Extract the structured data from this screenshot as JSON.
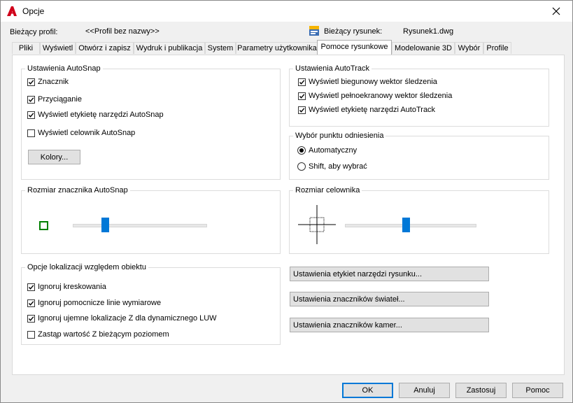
{
  "window": {
    "title": "Opcje",
    "close_glyph": "✕"
  },
  "header": {
    "profile_label": "Bieżący profil:",
    "profile_value": "<<Profil bez nazwy>>",
    "drawing_label": "Bieżący rysunek:",
    "drawing_value": "Rysunek1.dwg"
  },
  "tabs": [
    {
      "label": "Pliki"
    },
    {
      "label": "Wyświetl"
    },
    {
      "label": "Otwórz i zapisz"
    },
    {
      "label": "Wydruk i publikacja"
    },
    {
      "label": "System"
    },
    {
      "label": "Parametry użytkownika"
    },
    {
      "label": "Pomoce rysunkowe",
      "active": true
    },
    {
      "label": "Modelowanie 3D"
    },
    {
      "label": "Wybór"
    },
    {
      "label": "Profile"
    }
  ],
  "autosnap": {
    "title": "Ustawienia AutoSnap",
    "options": [
      {
        "label": "Znacznik",
        "checked": true
      },
      {
        "label": "Przyciąganie",
        "checked": true
      },
      {
        "label": "Wyświetl etykietę narzędzi AutoSnap",
        "checked": true
      },
      {
        "label": "Wyświetl celownik AutoSnap",
        "checked": false
      }
    ],
    "colors_button": "Kolory..."
  },
  "autotrack": {
    "title": "Ustawienia AutoTrack",
    "options": [
      {
        "label": "Wyświetl biegunowy wektor śledzenia",
        "checked": true
      },
      {
        "label": "Wyświetl pełnoekranowy wektor śledzenia",
        "checked": true
      },
      {
        "label": "Wyświetl etykietę narzędzi AutoTrack",
        "checked": true
      }
    ]
  },
  "point_selection": {
    "title": "Wybór punktu odniesienia",
    "options": [
      {
        "label": "Automatyczny",
        "selected": true
      },
      {
        "label": "Shift, aby wybrać",
        "selected": false
      }
    ]
  },
  "marker_size": {
    "title": "Rozmiar znacznika AutoSnap",
    "marker_color": "#008000",
    "slider_value": 0.23
  },
  "aperture_size": {
    "title": "Rozmiar celownika",
    "slider_value": 0.47
  },
  "object_snap": {
    "title": "Opcje lokalizacji względem obiektu",
    "options": [
      {
        "label": "Ignoruj kreskowania",
        "checked": true
      },
      {
        "label": "Ignoruj pomocnicze linie wymiarowe",
        "checked": true
      },
      {
        "label": "Ignoruj ujemne lokalizacje Z dla dynamicznego LUW",
        "checked": true
      },
      {
        "label": "Zastąp wartość Z bieżącym poziomem",
        "checked": false
      }
    ]
  },
  "settings_buttons": {
    "tooltip": "Ustawienia etykiet narzędzi rysunku...",
    "lights": "Ustawienia znaczników świateł...",
    "cameras": "Ustawienia znaczników kamer..."
  },
  "footer": {
    "ok": "OK",
    "cancel": "Anuluj",
    "apply": "Zastosuj",
    "help": "Pomoc"
  },
  "colors": {
    "accent": "#0078d7",
    "app_icon": "#d0021b"
  }
}
